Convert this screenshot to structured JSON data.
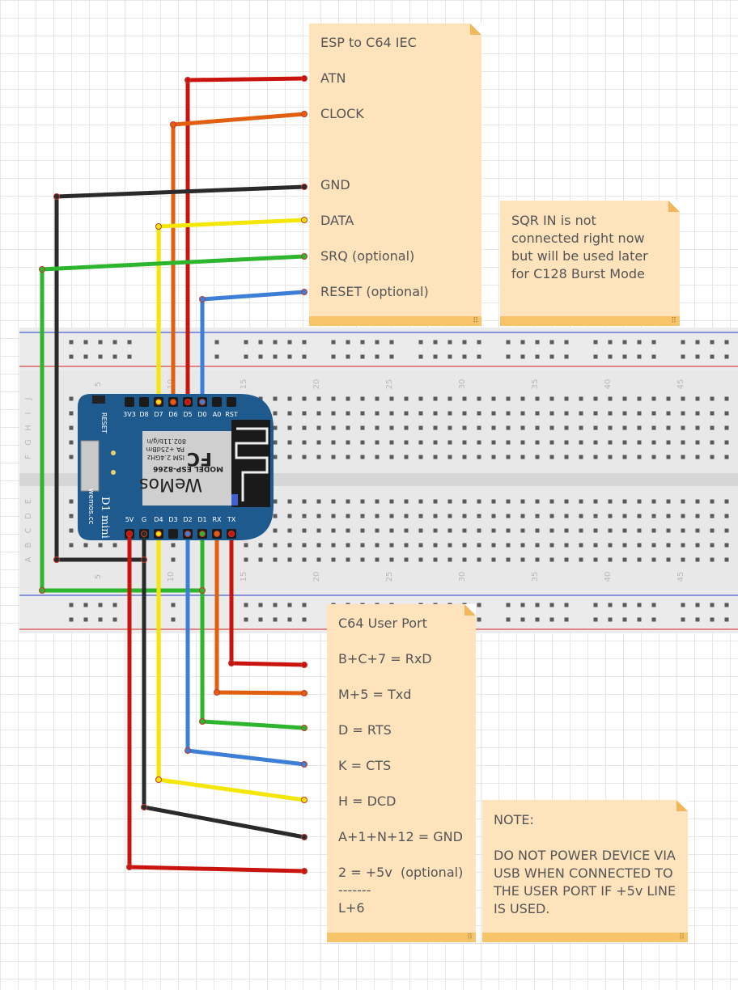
{
  "iec_note": {
    "title": "ESP to C64 IEC",
    "lines": [
      "ATN",
      "CLOCK",
      "",
      "GND",
      "DATA",
      "SRQ (optional)",
      "RESET (optional)"
    ]
  },
  "srq_note": {
    "lines": [
      "SQR IN is not",
      "connected right now",
      "but will be used later",
      "for C128 Burst Mode"
    ]
  },
  "userport_note": {
    "title": "C64 User Port",
    "lines": [
      "B+C+7 = RxD",
      "M+5 = Txd",
      "D = RTS",
      "K = CTS",
      "H = DCD",
      "A+1+N+12 = GND",
      "2 = +5v  (optional)",
      "-------",
      "L+6"
    ]
  },
  "warning_note": {
    "title": "NOTE:",
    "lines": [
      "DO NOT POWER DEVICE VIA",
      "USB WHEN CONNECTED TO",
      "THE USER PORT IF +5v LINE",
      "IS USED."
    ]
  },
  "board": {
    "top_pins": [
      "3V3",
      "D8",
      "D7",
      "D6",
      "D5",
      "D0",
      "A0",
      "RST"
    ],
    "bottom_pins": [
      "5V",
      "G",
      "D4",
      "D3",
      "D2",
      "D1",
      "RX",
      "TX"
    ],
    "reset_label": "RESET",
    "name": "D1 mini",
    "brand": "WeMos",
    "site": "wemos.cc",
    "module_model": "MODEL ESP-8266",
    "module_spec1": "ISM 2.4GHz",
    "module_spec2": "PA +25dBm",
    "module_spec3": "802.11b/g/n",
    "fcc": "FC"
  },
  "breadboard": {
    "column_numbers": [
      "5",
      "10",
      "15",
      "20",
      "25",
      "30",
      "35",
      "40",
      "45"
    ],
    "row_letters_top": [
      "J",
      "I",
      "H",
      "G",
      "F"
    ],
    "row_letters_bottom": [
      "E",
      "D",
      "C",
      "B",
      "A"
    ]
  },
  "wire_colors": {
    "red": "#c9140e",
    "orange": "#e0600f",
    "black": "#2a2a2a",
    "yellow": "#f4e607",
    "green": "#2db52d",
    "blue": "#3d7fd6"
  }
}
